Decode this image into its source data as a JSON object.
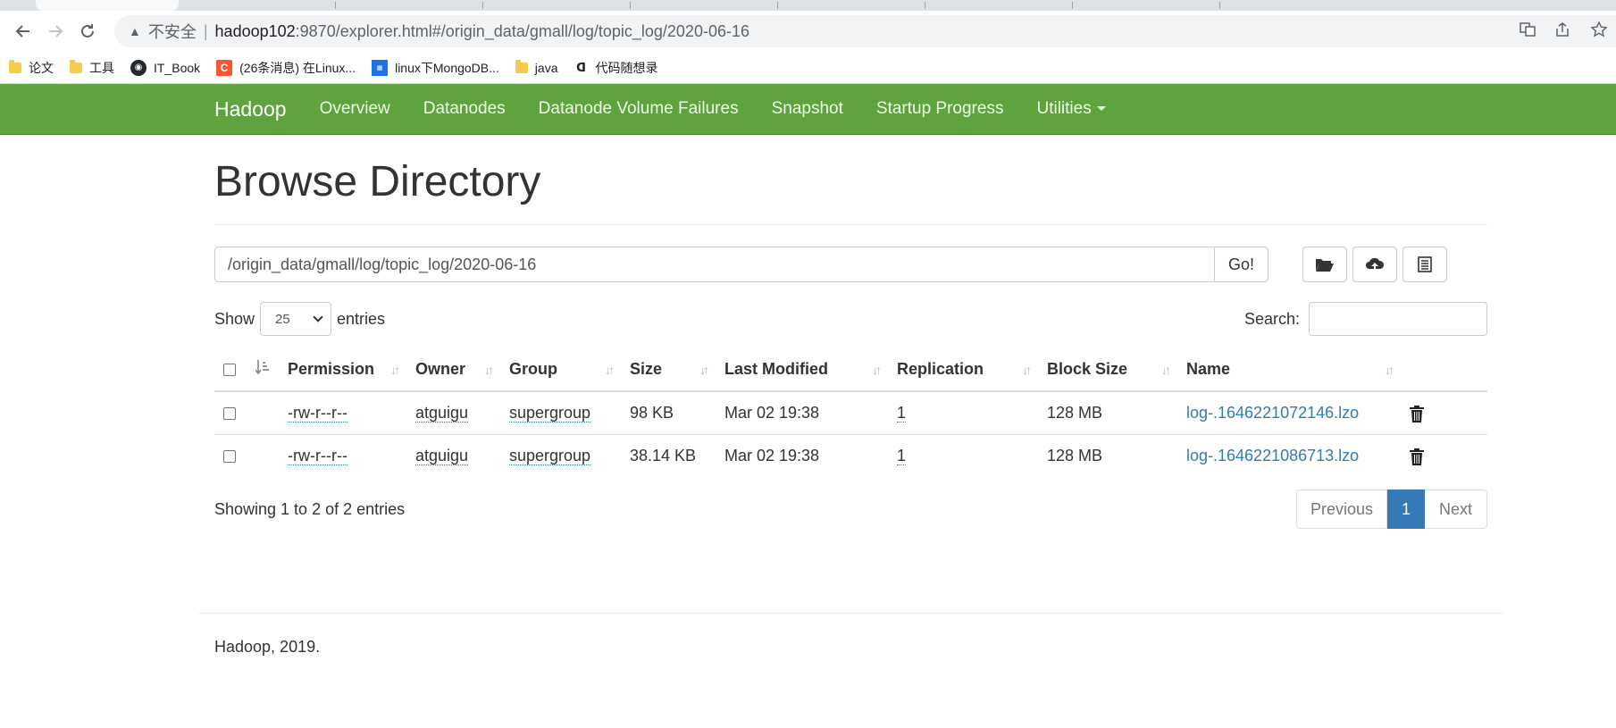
{
  "browser": {
    "insecure_label": "不安全",
    "pipe": "|",
    "url_host": "hadoop102",
    "url_path": ":9870/explorer.html#/origin_data/gmall/log/topic_log/2020-06-16",
    "bookmarks": [
      {
        "icon": "folder-icon",
        "label": "论文"
      },
      {
        "icon": "folder-icon",
        "label": "工具"
      },
      {
        "icon": "github-icon",
        "label": "IT_Book"
      },
      {
        "icon": "csdn-icon",
        "label": "(26条消息) 在Linux..."
      },
      {
        "icon": "site-icon",
        "label": "linux下MongoDB..."
      },
      {
        "icon": "folder-icon",
        "label": "java"
      },
      {
        "icon": "doc-icon",
        "label": "代码随想录"
      }
    ]
  },
  "navbar": {
    "brand": "Hadoop",
    "links": [
      "Overview",
      "Datanodes",
      "Datanode Volume Failures",
      "Snapshot",
      "Startup Progress",
      "Utilities"
    ]
  },
  "page": {
    "title": "Browse Directory",
    "directory_value": "/origin_data/gmall/log/topic_log/2020-06-16",
    "go_label": "Go!",
    "show_label": "Show",
    "entries_value": "25",
    "entries_label": "entries",
    "search_label": "Search:"
  },
  "table": {
    "columns": [
      "Permission",
      "Owner",
      "Group",
      "Size",
      "Last Modified",
      "Replication",
      "Block Size",
      "Name"
    ],
    "rows": [
      {
        "permission": "-rw-r--r--",
        "owner": "atguigu",
        "group": "supergroup",
        "size": "98 KB",
        "modified": "Mar 02 19:38",
        "replication": "1",
        "block_size": "128 MB",
        "name": "log-.1646221072146.lzo"
      },
      {
        "permission": "-rw-r--r--",
        "owner": "atguigu",
        "group": "supergroup",
        "size": "38.14 KB",
        "modified": "Mar 02 19:38",
        "replication": "1",
        "block_size": "128 MB",
        "name": "log-.1646221086713.lzo"
      }
    ]
  },
  "footer_info": {
    "showing": "Showing 1 to 2 of 2 entries",
    "prev": "Previous",
    "page": "1",
    "next": "Next",
    "copyright": "Hadoop, 2019."
  },
  "colors": {
    "navbar": "#5fa33e",
    "link": "#337ab7",
    "active_page": "#337ab7"
  }
}
